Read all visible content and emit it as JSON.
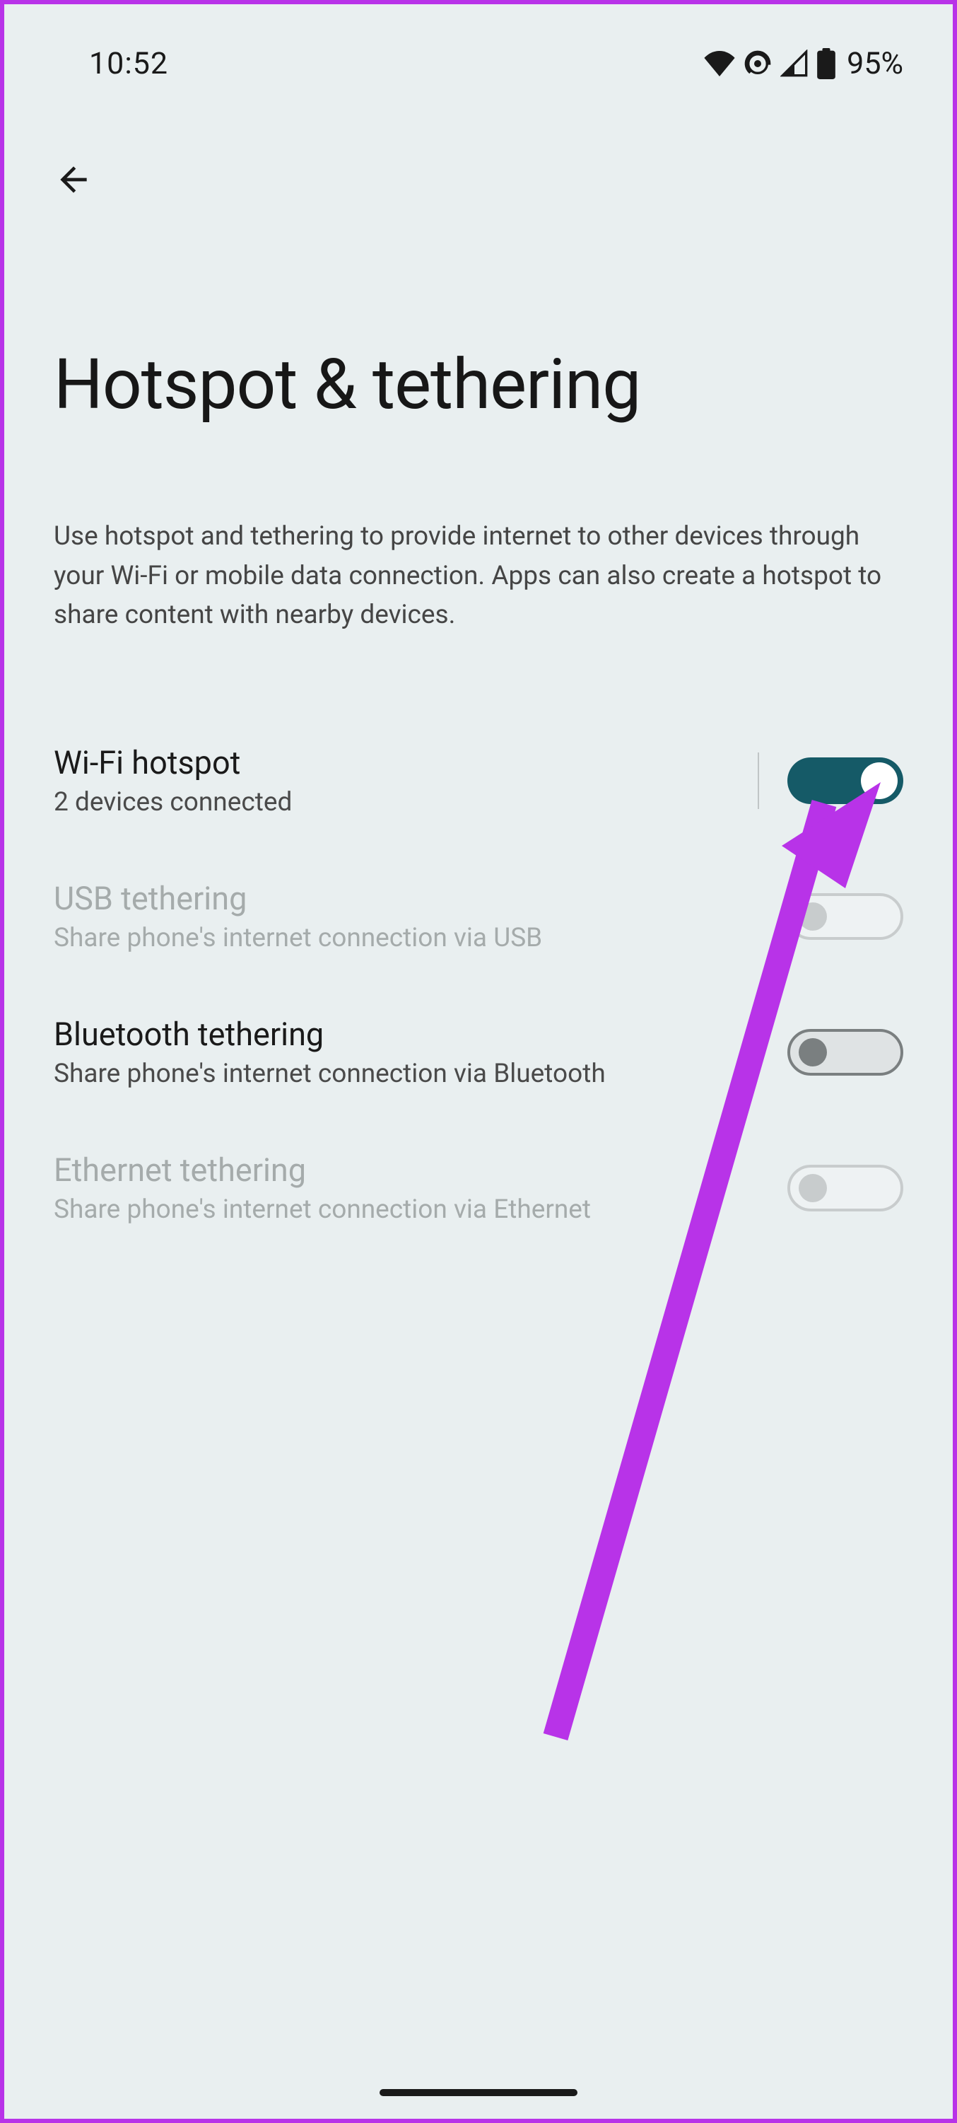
{
  "status_bar": {
    "time": "10:52",
    "battery_pct": "95%"
  },
  "page": {
    "title": "Hotspot & tethering",
    "description": "Use hotspot and tethering to provide internet to other devices through your Wi-Fi or mobile data connection. Apps can also create a hotspot to share content with nearby devices."
  },
  "settings": [
    {
      "title": "Wi-Fi hotspot",
      "subtitle": "2 devices connected",
      "enabled": true,
      "toggled": true,
      "has_divider": true
    },
    {
      "title": "USB tethering",
      "subtitle": "Share phone's internet connection via USB",
      "enabled": false,
      "toggled": false,
      "has_divider": false
    },
    {
      "title": "Bluetooth tethering",
      "subtitle": "Share phone's internet connection via Bluetooth",
      "enabled": true,
      "toggled": false,
      "has_divider": false
    },
    {
      "title": "Ethernet tethering",
      "subtitle": "Share phone's internet connection via Ethernet",
      "enabled": false,
      "toggled": false,
      "has_divider": false
    }
  ],
  "annotation": {
    "color": "#b833e8"
  }
}
